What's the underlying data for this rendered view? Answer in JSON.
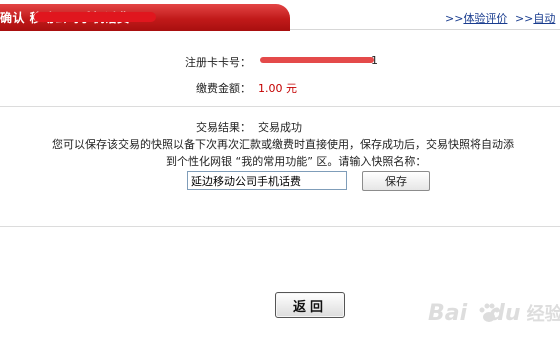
{
  "header": {
    "title": "确认    移动公司手机话费",
    "link_evaluate": "体验评价",
    "link_auto": "自动",
    "link_arrow": ">>",
    "link_arrow2": ">>"
  },
  "form": {
    "card_label": "注册卡卡号：",
    "card_tail": "1",
    "amount_label": "缴费金额：",
    "amount_value": "1.00 元",
    "result_label": "交易结果：",
    "result_value": "交易成功",
    "info_line1": "您可以保存该交易的快照以备下次再次汇款或缴费时直接使用，保存成功后，交易快照将自动添",
    "info_line2": "到个性化网银 “我的常用功能” 区。请输入快照名称：",
    "snapshot_name": "延边移动公司手机话费",
    "save_label": "保存",
    "back_label": "返回"
  },
  "watermark": {
    "brand": "Bai",
    "brand2": "du",
    "cn": "经验"
  },
  "colors": {
    "header_red": "#c11a1a",
    "link_blue": "#1a3d8f",
    "amount_red": "#c40000"
  }
}
